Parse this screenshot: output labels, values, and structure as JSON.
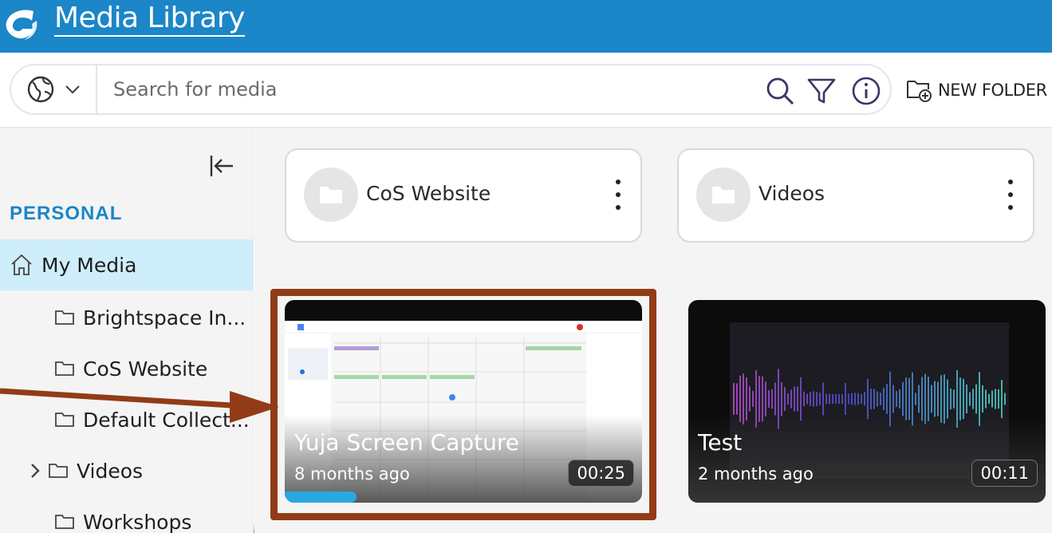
{
  "header": {
    "title": "Media Library"
  },
  "search": {
    "placeholder": "Search for media",
    "new_folder_label": "NEW FOLDER"
  },
  "sidebar": {
    "section": "PERSONAL",
    "items": [
      {
        "label": "My Media",
        "icon": "home-icon",
        "active": true
      },
      {
        "label": "Brightspace In...",
        "icon": "folder-icon"
      },
      {
        "label": "CoS Website",
        "icon": "folder-icon"
      },
      {
        "label": "Default Collect...",
        "icon": "folder-icon"
      },
      {
        "label": "Videos",
        "icon": "folder-icon",
        "expandable": true
      },
      {
        "label": "Workshops",
        "icon": "folder-icon"
      }
    ]
  },
  "folders": [
    {
      "name": "CoS Website"
    },
    {
      "name": "Videos"
    }
  ],
  "media": [
    {
      "title": "Yuja Screen Capture",
      "age": "8 months ago",
      "duration": "00:25",
      "progress": 0.2,
      "highlighted": true
    },
    {
      "title": "Test",
      "age": "2 months ago",
      "duration": "00:11",
      "progress": 0
    }
  ],
  "colors": {
    "brand": "#1b86c8",
    "active_nav": "#cfeefb",
    "highlight": "#923c17",
    "progress": "#29a8e0"
  }
}
